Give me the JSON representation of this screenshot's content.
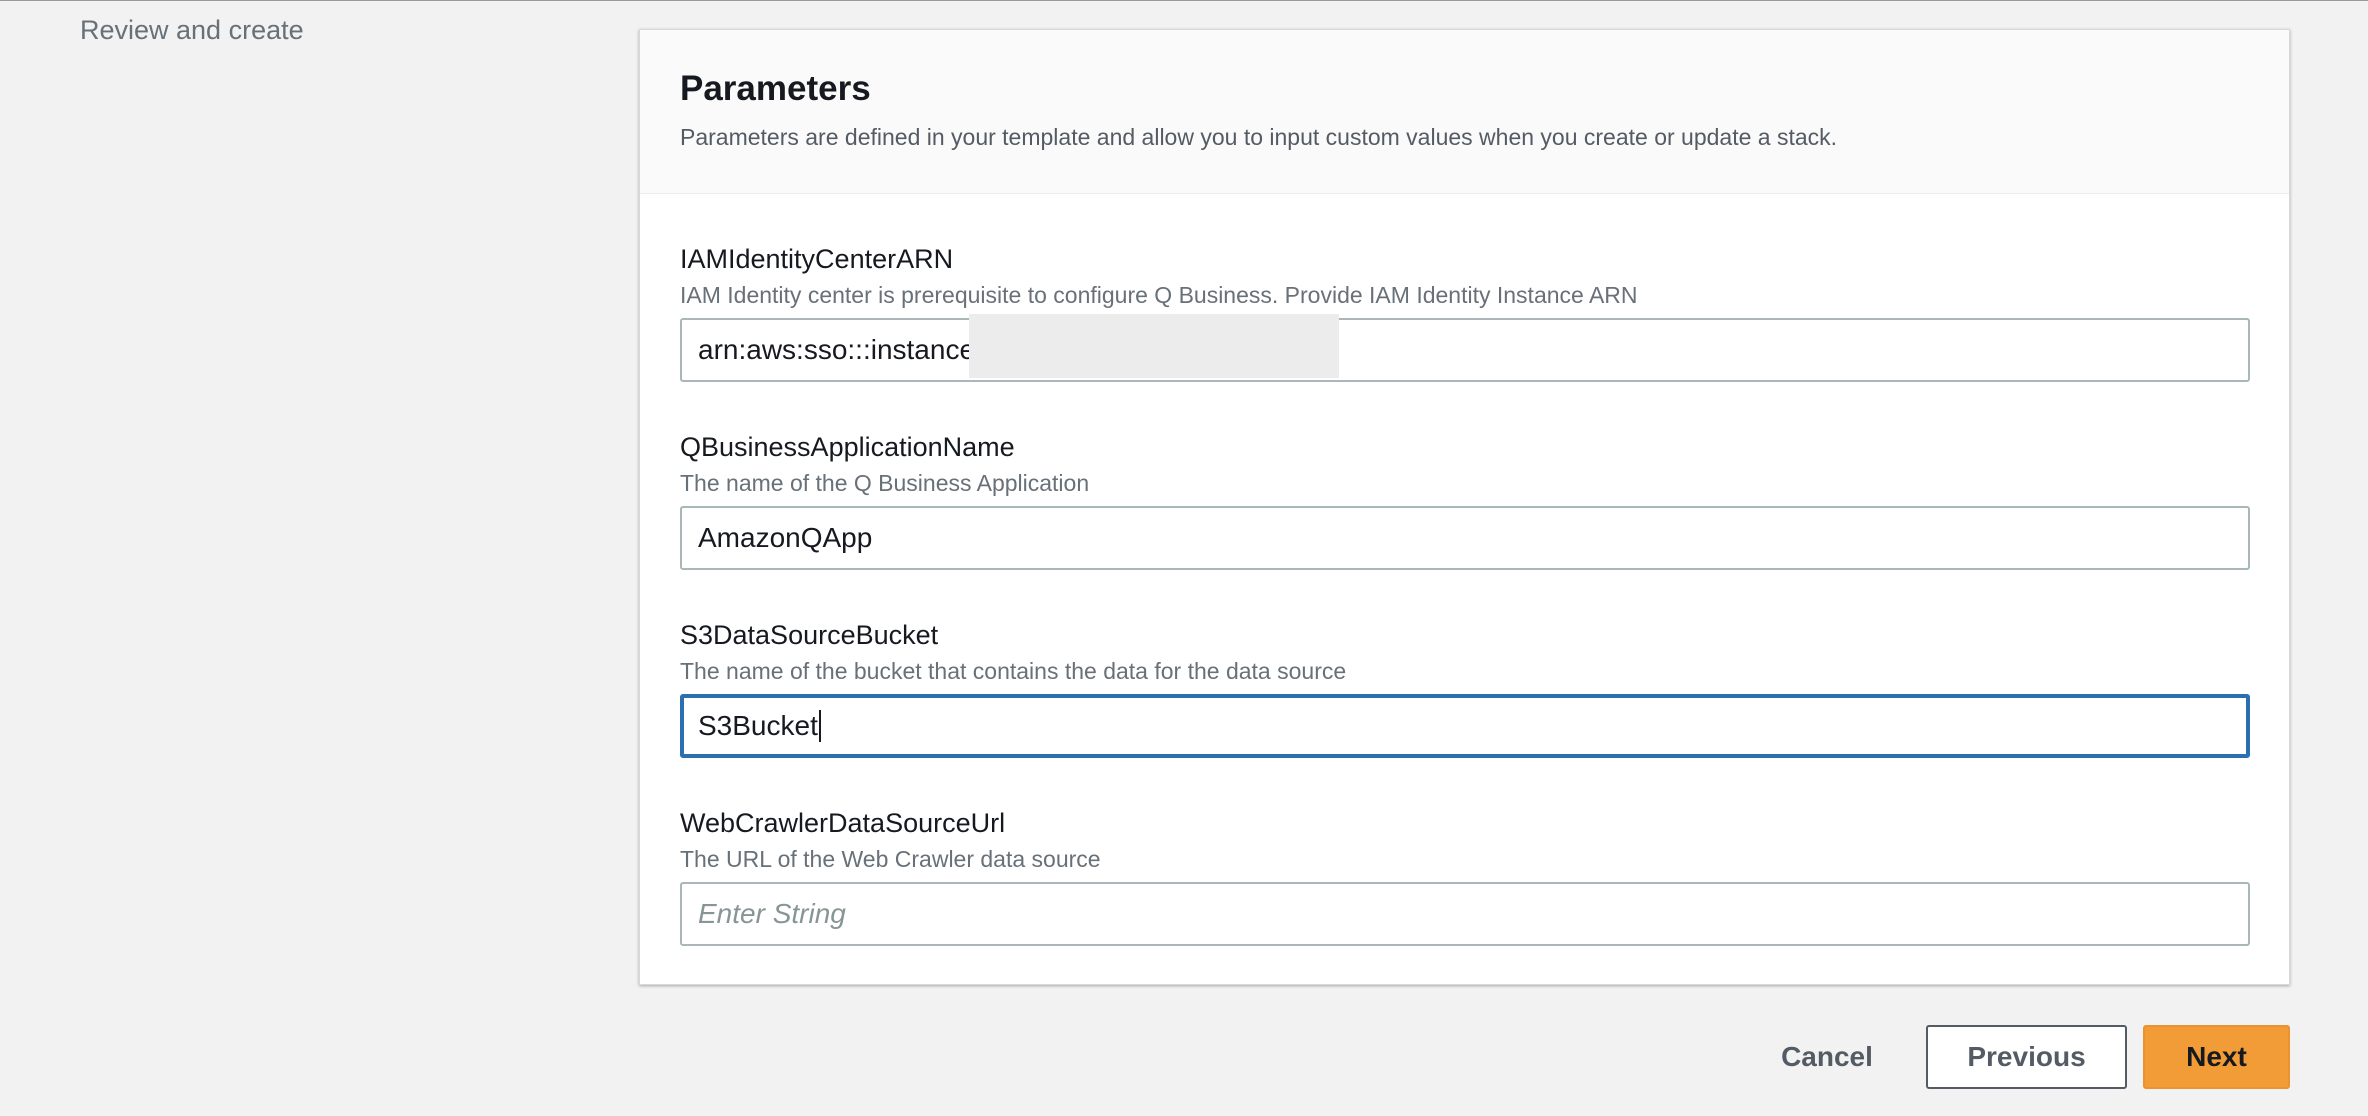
{
  "sidebar": {
    "current_step": "Review and create"
  },
  "panel": {
    "title": "Parameters",
    "description": "Parameters are defined in your template and allow you to input custom values when you create or update a stack."
  },
  "fields": [
    {
      "label": "IAMIdentityCenterARN",
      "description": "IAM Identity center is prerequisite to configure Q Business. Provide IAM Identity Instance ARN",
      "value": "arn:aws:sso:::instance",
      "placeholder": ""
    },
    {
      "label": "QBusinessApplicationName",
      "description": "The name of the Q Business Application",
      "value": "AmazonQApp",
      "placeholder": ""
    },
    {
      "label": "S3DataSourceBucket",
      "description": "The name of the bucket that contains the data for the data source",
      "value": "S3Bucket",
      "placeholder": ""
    },
    {
      "label": "WebCrawlerDataSourceUrl",
      "description": "The URL of the Web Crawler data source",
      "value": "",
      "placeholder": "Enter String"
    }
  ],
  "footer": {
    "cancel_label": "Cancel",
    "previous_label": "Previous",
    "next_label": "Next"
  },
  "colors": {
    "primary_button": "#f19c36",
    "focus_border": "#2a6fb0",
    "page_background": "#f2f2f2"
  }
}
